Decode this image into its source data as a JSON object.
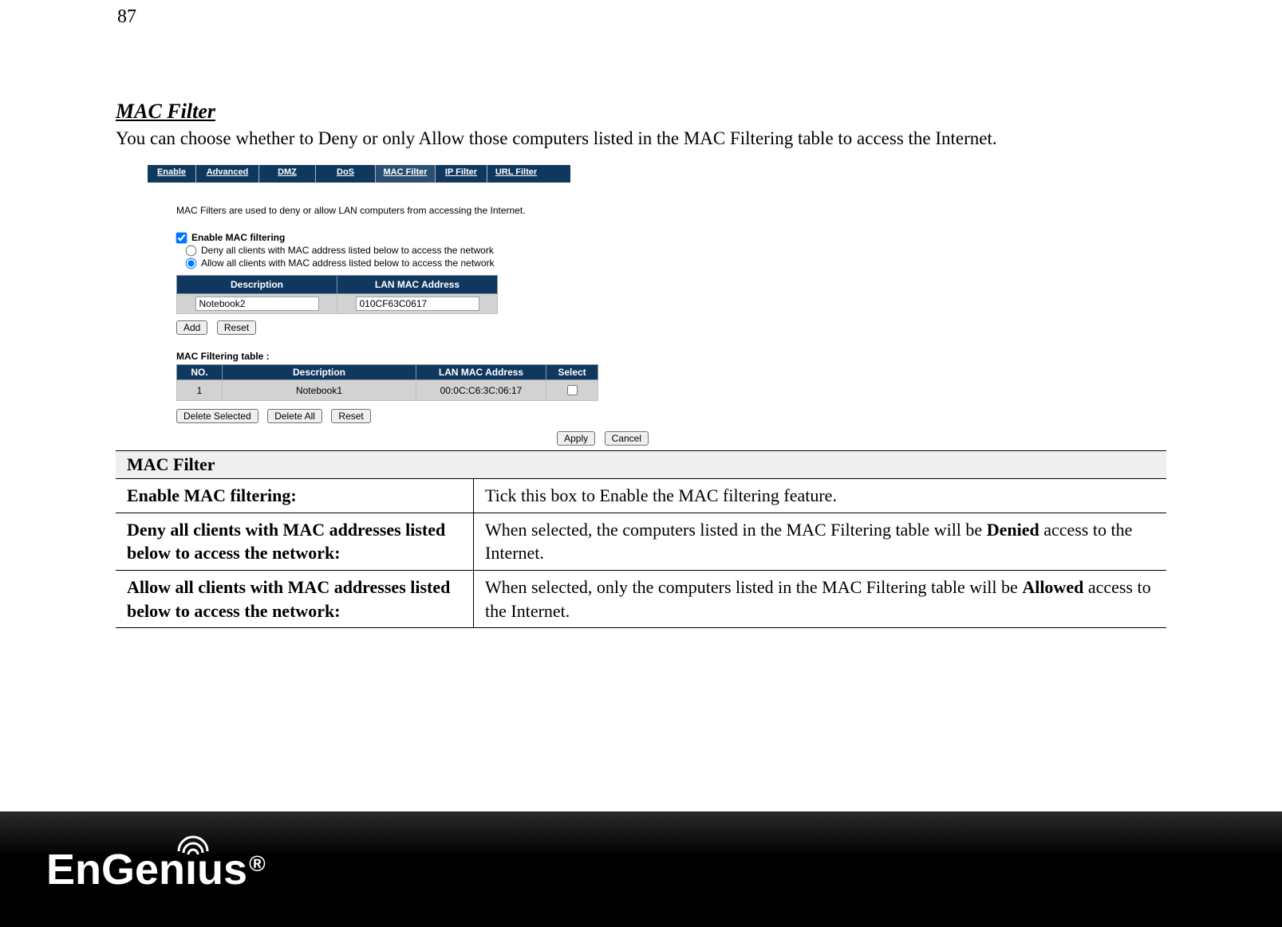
{
  "page_number": "87",
  "section_title": "MAC Filter",
  "intro_text": "You can choose whether to Deny or only Allow those computers listed in the MAC Filtering table to access the Internet.",
  "screenshot": {
    "tabs": {
      "enable": "Enable",
      "advanced": "Advanced",
      "dmz": "DMZ",
      "dos": "DoS",
      "mac_filter": "MAC Filter",
      "ip_filter": "IP Filter",
      "url_filter": "URL Filter"
    },
    "description": "MAC Filters are used to deny or allow LAN computers from accessing the Internet.",
    "enable_checkbox_label": "Enable MAC filtering",
    "enable_checkbox_checked": true,
    "radio_deny_label": "Deny all clients with MAC address listed below to access the network",
    "radio_allow_label": "Allow all clients with MAC address listed below to access the network",
    "radio_selected": "allow",
    "input_table": {
      "header_description": "Description",
      "header_mac": "LAN MAC Address",
      "value_description": "Notebook2",
      "value_mac": "010CF63C0617"
    },
    "buttons": {
      "add": "Add",
      "reset": "Reset",
      "delete_selected": "Delete Selected",
      "delete_all": "Delete All",
      "reset2": "Reset",
      "apply": "Apply",
      "cancel": "Cancel"
    },
    "filter_table": {
      "caption": "MAC Filtering table :",
      "header_no": "NO.",
      "header_description": "Description",
      "header_mac": "LAN MAC Address",
      "header_select": "Select",
      "rows": [
        {
          "no": "1",
          "description": "Notebook1",
          "mac": "00:0C:C6:3C:06:17",
          "checked": false
        }
      ]
    }
  },
  "param_table": {
    "header": "MAC Filter",
    "rows": [
      {
        "label": "Enable MAC filtering:",
        "value_pre": "Tick this box to Enable the MAC filtering feature.",
        "value_bold": "",
        "value_post": ""
      },
      {
        "label": "Deny all clients with MAC addresses listed below to access the network:",
        "value_pre": "When selected, the computers listed in the MAC Filtering table will be ",
        "value_bold": "Denied",
        "value_post": " access to the Internet."
      },
      {
        "label": "Allow all clients with MAC addresses listed below to access the network:",
        "value_pre": "When selected, only the computers listed in the MAC Filtering table will be ",
        "value_bold": "Allowed",
        "value_post": " access to the Internet."
      }
    ]
  },
  "footer": {
    "brand_pre": "EnGen",
    "brand_i": "ı",
    "brand_post": "us",
    "reg": "®"
  }
}
